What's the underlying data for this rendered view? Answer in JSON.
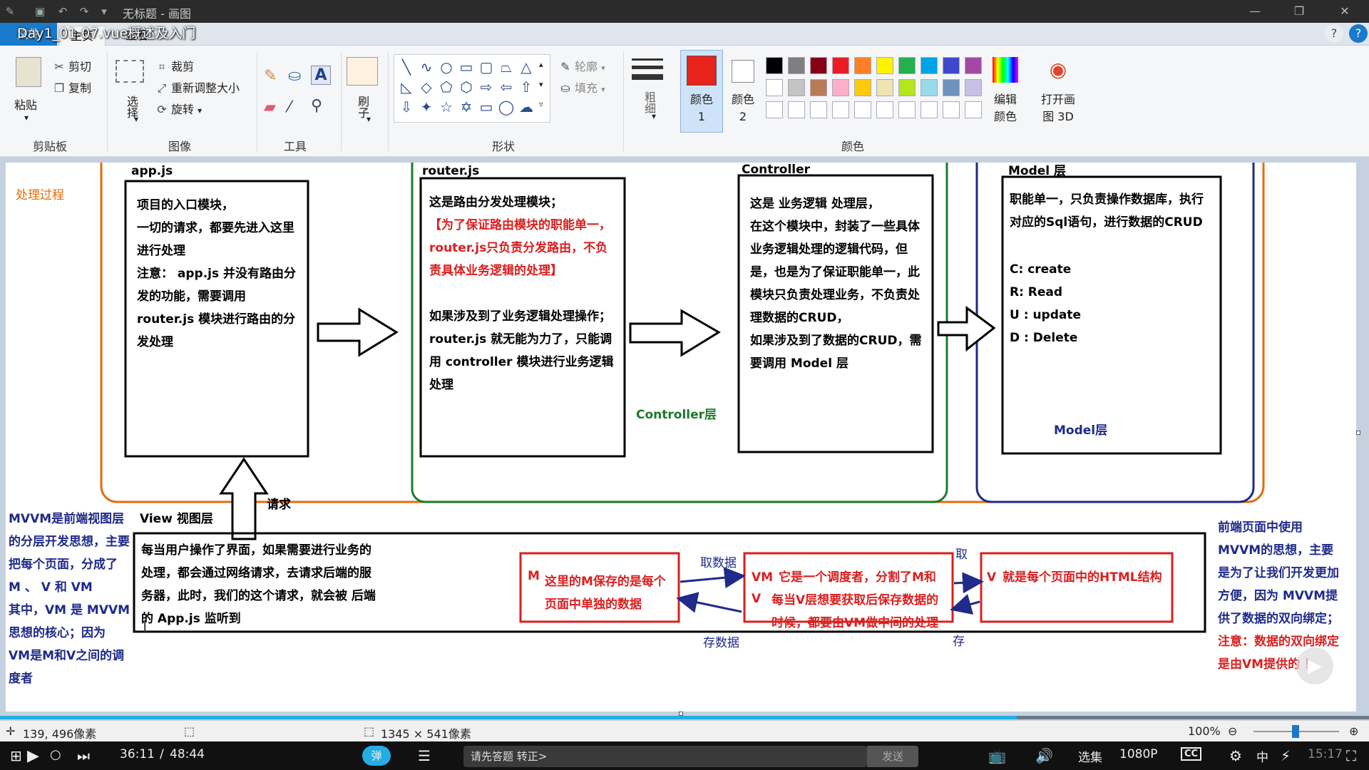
{
  "window": {
    "title": "无标题 - 画图"
  },
  "video": {
    "title": "Day1_01-07.vue概述及入门",
    "time_current": "36:11",
    "time_total": "48:44",
    "danmaku_toggle": "弹",
    "danmaku_placeholder": "请先答题 转正>",
    "send_label": "发送",
    "episodes_label": "选集",
    "quality_label": "1080P",
    "cc_label": "CC",
    "ime_label": "中",
    "clock": "15:17"
  },
  "tabs": {
    "file": "文件",
    "home": "主页",
    "view": "查看"
  },
  "ribbon": {
    "clipboard": {
      "paste": "粘贴",
      "cut": "剪切",
      "copy": "复制",
      "label": "剪贴板"
    },
    "image": {
      "select": "选择",
      "crop": "裁剪",
      "resize": "重新调整大小",
      "rotate": "旋转",
      "label": "图像"
    },
    "tools": {
      "label": "工具"
    },
    "brush": {
      "label": "刷子"
    },
    "shapes": {
      "outline": "轮廓",
      "fill": "填充",
      "label": "形状"
    },
    "size": {
      "label": "粗细"
    },
    "colors": {
      "color1": "颜色 1",
      "color2": "颜色 2",
      "edit": "编辑颜色",
      "paint3d": "打开画图 3D",
      "label": "颜色",
      "color1_value": "#e8231b",
      "palette": [
        "#000000",
        "#7f7f7f",
        "#880015",
        "#ed1c24",
        "#ff7f27",
        "#fff200",
        "#22b14c",
        "#00a2e8",
        "#3f48cc",
        "#a349a4",
        "#ffffff",
        "#c3c3c3",
        "#b97a57",
        "#ffaec9",
        "#ffc90e",
        "#efe4b0",
        "#b5e61d",
        "#99d9ea",
        "#7092be",
        "#c8bfe7"
      ]
    }
  },
  "diagram": {
    "side_title": "处理过程",
    "app": {
      "title": "app.js",
      "lines": [
        "项目的入口模块，",
        "一切的请求，都要先进入这里",
        "进行处理",
        "注意： app.js 并没有路由分",
        "发的功能，需要调用",
        "router.js 模块进行路由的分",
        "发处理"
      ]
    },
    "router": {
      "title": "router.js",
      "line1": "这是路由分发处理模块；",
      "red_lines": [
        "【为了保证路由模块的职能单一，",
        "router.js只负责分发路由，不负",
        "责具体业务逻辑的处理】"
      ],
      "lines": [
        "如果涉及到了业务逻辑处理操作；",
        "router.js 就无能为力了，只能调",
        "用 controller 模块进行业务逻辑",
        "处理"
      ]
    },
    "controller": {
      "title": "Controller",
      "layer_label": "Controller层",
      "lines": [
        "这是 业务逻辑 处理层，",
        "在这个模块中，封装了一些具体",
        "业务逻辑处理的逻辑代码，但",
        "是，也是为了保证职能单一，此",
        "模块只负责处理业务，不负责处",
        "理数据的CRUD，",
        "如果涉及到了数据的CRUD，需",
        "要调用 Model 层"
      ]
    },
    "model": {
      "title": "Model 层",
      "layer_label": "Model层",
      "lines": [
        "职能单一，只负责操作数据库，执行",
        "对应的Sql语句，进行数据的CRUD"
      ],
      "crud": [
        "C:  create",
        "R: Read",
        "U : update",
        "D : Delete"
      ]
    },
    "request_label": "请求",
    "view": {
      "title": "View 视图层",
      "lines": [
        "每当用户操作了界面，如果需要进行业务的",
        "处理，都会通过网络请求，去请求后端的服",
        "务器，此时，我们的这个请求，就会被 后端",
        "的 App.js 监听到"
      ]
    },
    "mvvm_left": [
      "MVVM是前端视图层",
      "的分层开发思想，主要",
      "把每个页面，分成了",
      "M 、 V 和 VM",
      "其中，VM 是 MVVM",
      "思想的核心；因为",
      "VM是M和V之间的调",
      "度者"
    ],
    "m_box": {
      "tag": "M",
      "lines": [
        "这里的M保存的是每个",
        "页面中单独的数据"
      ]
    },
    "vm_box": {
      "tag1": "VM",
      "tag2": "V",
      "lines": [
        "它是一个调度者，分割了M和",
        "每当V层想要获取后保存数据的",
        "时候，都要由VM做中间的处理"
      ]
    },
    "v_box": {
      "tag": "V",
      "line": "就是每个页面中的HTML结构"
    },
    "arrows": {
      "fetch_data": "取数据",
      "save_data": "存数据",
      "fetch": "取",
      "save": "存"
    },
    "mvvm_right": [
      "前端页面中使用",
      "MVVM的思想，主要",
      "是为了让我们开发更加",
      "方便，因为 MVVM提",
      "供了数据的双向绑定；",
      "注意：数据的双向绑定",
      "是由VM提供的 ！"
    ]
  },
  "status": {
    "cursor_pos": "139, 496像素",
    "selection_size": "1345 × 541像素",
    "zoom": "100%"
  }
}
